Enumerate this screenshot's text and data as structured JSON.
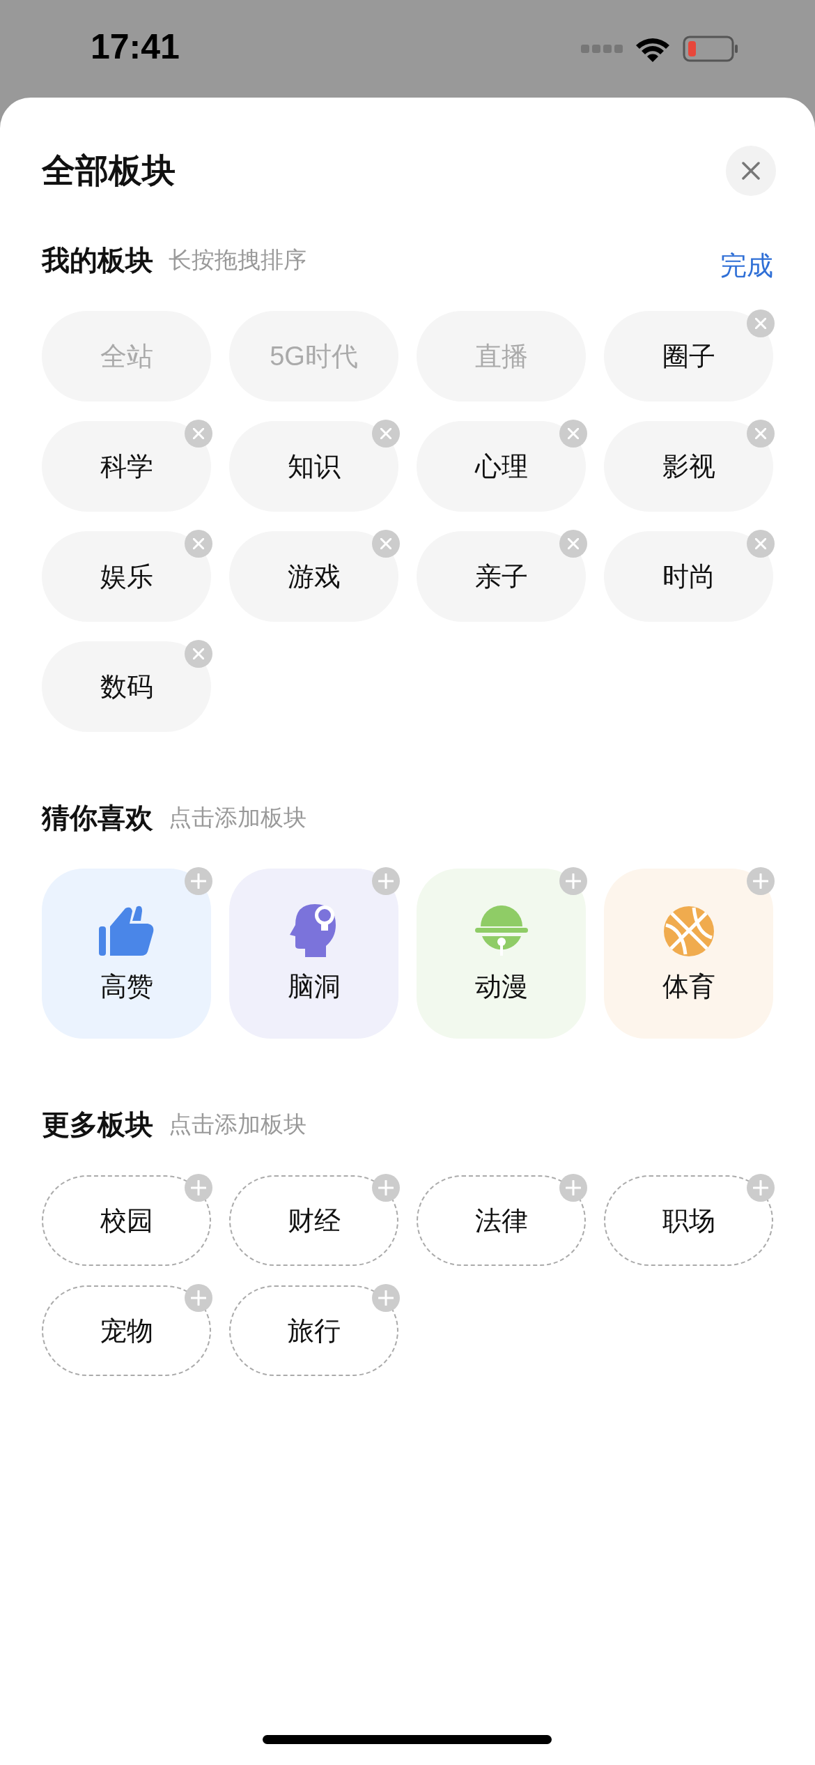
{
  "status_bar": {
    "time": "17:41"
  },
  "sheet": {
    "title": "全部板块"
  },
  "my_sections": {
    "title": "我的板块",
    "hint": "长按拖拽排序",
    "action": "完成",
    "items": [
      {
        "label": "全站",
        "fixed": true
      },
      {
        "label": "5G时代",
        "fixed": true
      },
      {
        "label": "直播",
        "fixed": true
      },
      {
        "label": "圈子",
        "fixed": false
      },
      {
        "label": "科学",
        "fixed": false
      },
      {
        "label": "知识",
        "fixed": false
      },
      {
        "label": "心理",
        "fixed": false
      },
      {
        "label": "影视",
        "fixed": false
      },
      {
        "label": "娱乐",
        "fixed": false
      },
      {
        "label": "游戏",
        "fixed": false
      },
      {
        "label": "亲子",
        "fixed": false
      },
      {
        "label": "时尚",
        "fixed": false
      },
      {
        "label": "数码",
        "fixed": false
      }
    ]
  },
  "suggested": {
    "title": "猜你喜欢",
    "hint": "点击添加板块",
    "items": [
      {
        "label": "高赞",
        "kind": "thumb",
        "color": "#4a86e8"
      },
      {
        "label": "脑洞",
        "kind": "head",
        "color": "#7b73db"
      },
      {
        "label": "动漫",
        "kind": "bell",
        "color": "#8fcc66"
      },
      {
        "label": "体育",
        "kind": "ball",
        "color": "#f0ab4e"
      }
    ]
  },
  "more_sections": {
    "title": "更多板块",
    "hint": "点击添加板块",
    "items": [
      {
        "label": "校园"
      },
      {
        "label": "财经"
      },
      {
        "label": "法律"
      },
      {
        "label": "职场"
      },
      {
        "label": "宠物"
      },
      {
        "label": "旅行"
      }
    ]
  }
}
